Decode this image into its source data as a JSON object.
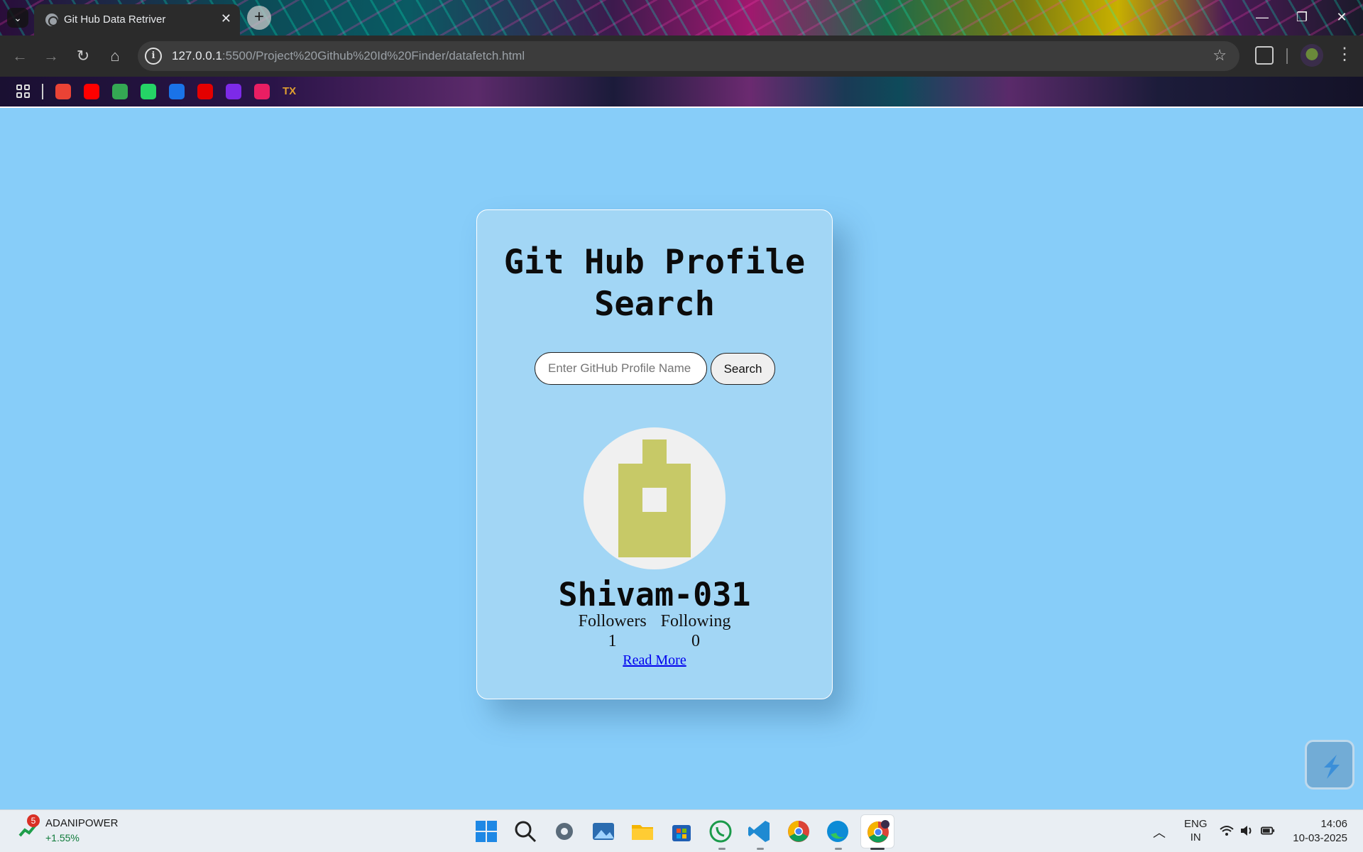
{
  "browser": {
    "tab_title": "Git Hub Data Retriver",
    "url_host": "127.0.0.1",
    "url_rest": ":5500/Project%20Github%20Id%20Finder/datafetch.html"
  },
  "bookmarks": [
    {
      "name": "gmail",
      "color": "#ea4335"
    },
    {
      "name": "youtube",
      "color": "#ff0000"
    },
    {
      "name": "maps",
      "color": "#34a853"
    },
    {
      "name": "whatsapp",
      "color": "#25d366"
    },
    {
      "name": "play",
      "color": "#1a73e8"
    },
    {
      "name": "airtel",
      "color": "#e40000"
    },
    {
      "name": "canva",
      "color": "#7d2ae8"
    },
    {
      "name": "gift",
      "color": "#e91e63"
    }
  ],
  "bookmark_text": "TX",
  "app": {
    "title": "Git Hub Profile Search",
    "search_placeholder": "Enter GitHub Profile Name",
    "search_button": "Search",
    "username": "Shivam-031",
    "followers_label": "Followers",
    "followers_count": "1",
    "following_label": "Following",
    "following_count": "0",
    "read_more": "Read More",
    "avatar_color": "#c7c967"
  },
  "taskbar": {
    "stock_name": "ADANIPOWER",
    "stock_change": "+1.55%",
    "stock_badge": "5",
    "lang_top": "ENG",
    "lang_bottom": "IN",
    "time": "14:06",
    "date": "10-03-2025"
  }
}
